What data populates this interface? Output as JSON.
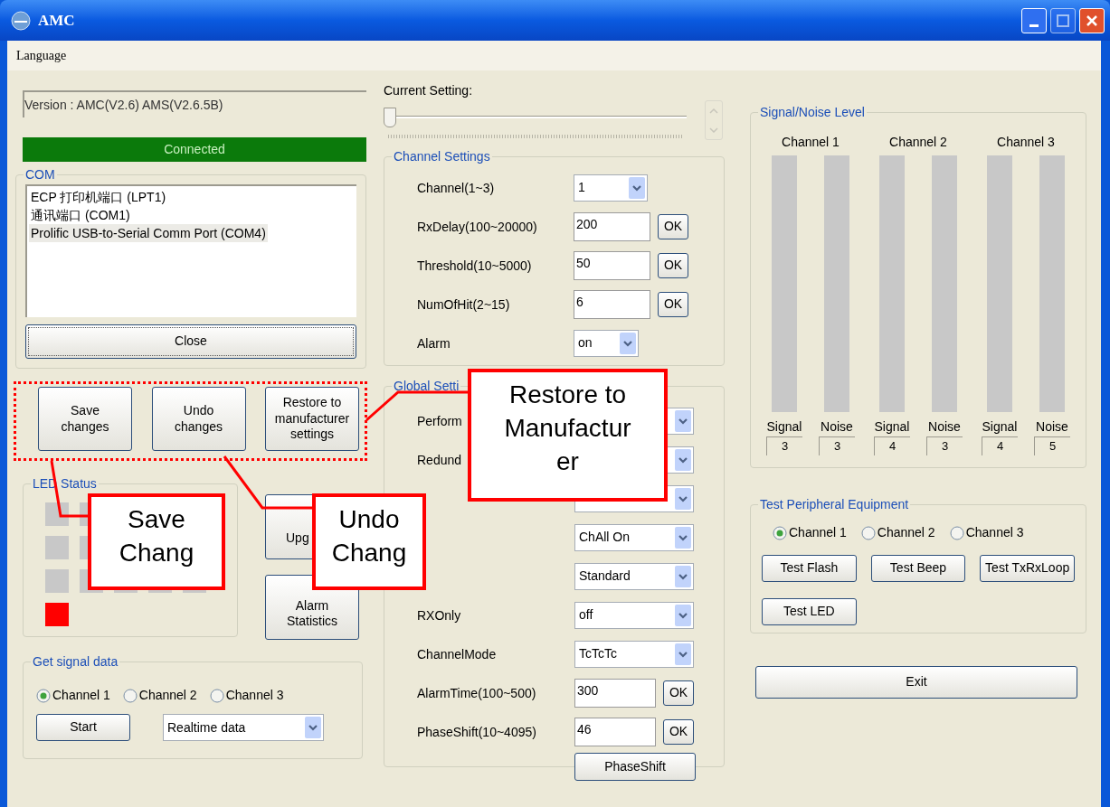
{
  "window": {
    "title": "AMC"
  },
  "menu": [
    "Language"
  ],
  "version": {
    "value": "Version :  AMC(V2.6)  AMS(V2.6.5B)"
  },
  "connection": {
    "status": "Connected",
    "connected": true
  },
  "com": {
    "legend": "COM",
    "ports": [
      {
        "label": "ECP 打印机端口 (LPT1)",
        "selected": false
      },
      {
        "label": "通讯端口 (COM1)",
        "selected": false
      },
      {
        "label": "Prolific USB-to-Serial Comm Port (COM4)",
        "selected": true
      }
    ],
    "close_button": "Close"
  },
  "actions": [
    "Save changes",
    "Undo changes",
    "Restore to manufacturer settings"
  ],
  "led_status": {
    "legend": "LED Status",
    "rows": [
      [
        {
          "color": "#c8c8c8"
        },
        {
          "color": "#c8c8c8"
        }
      ],
      [
        {
          "color": "#c8c8c8"
        },
        {
          "color": "#c8c8c8"
        }
      ],
      [
        {
          "color": "#c8c8c8"
        },
        {
          "color": "#c8c8c8"
        },
        {
          "color": "#c8c8c8"
        },
        {
          "color": "#c8c8c8"
        },
        {
          "color": "#c8c8c8"
        }
      ],
      [
        {
          "color": "#ff0000"
        }
      ]
    ]
  },
  "side_buttons": [
    "Upg",
    "Alarm Statistics"
  ],
  "signal_data": {
    "legend": "Get signal data",
    "channels": [
      {
        "label": "Channel 1",
        "selected": true
      },
      {
        "label": "Channel 2",
        "selected": false
      },
      {
        "label": "Channel 3",
        "selected": false
      }
    ],
    "start_button": "Start",
    "mode": "Realtime data"
  },
  "current_setting": {
    "label": "Current Setting:",
    "level": 0
  },
  "channel_settings": {
    "legend": "Channel Settings",
    "rows": [
      {
        "kind": "select",
        "label": "Channel(1~3)",
        "value": "1"
      },
      {
        "kind": "input",
        "label": "RxDelay(100~20000)",
        "value": "200",
        "button": "OK"
      },
      {
        "kind": "input",
        "label": "Threshold(10~5000)",
        "value": "50",
        "button": "OK"
      },
      {
        "kind": "input",
        "label": "NumOfHit(2~15)",
        "value": "6",
        "button": "OK"
      },
      {
        "kind": "select",
        "label": "Alarm",
        "value": "on"
      }
    ]
  },
  "global_settings": {
    "legend": "Global Setti",
    "rows": [
      {
        "kind": "select",
        "label": "Perform"
      },
      {
        "kind": "select",
        "label": "Redund"
      },
      {
        "kind": "select"
      },
      {
        "kind": "select",
        "value": "ChAll On"
      },
      {
        "kind": "select",
        "value": "Standard"
      },
      {
        "kind": "select",
        "label": "RXOnly",
        "value": "off"
      },
      {
        "kind": "select",
        "label": "ChannelMode",
        "value": "TcTcTc"
      },
      {
        "kind": "input",
        "label": "AlarmTime(100~500)",
        "value": "300",
        "button": "OK"
      },
      {
        "kind": "input",
        "label": "PhaseShift(10~4095)",
        "value": "46",
        "button": "OK"
      }
    ],
    "phase_button": "PhaseShift"
  },
  "signal_noise": {
    "legend": "Signal/Noise Level",
    "channels": [
      {
        "name": "Channel 1",
        "meters": [
          {
            "label": "Signal",
            "value": "3"
          },
          {
            "label": "Noise",
            "value": "3"
          }
        ]
      },
      {
        "name": "Channel 2",
        "meters": [
          {
            "label": "Signal",
            "value": "4"
          },
          {
            "label": "Noise",
            "value": "3"
          }
        ]
      },
      {
        "name": "Channel 3",
        "meters": [
          {
            "label": "Signal",
            "value": "4"
          },
          {
            "label": "Noise",
            "value": "5"
          }
        ]
      }
    ]
  },
  "test_peripheral": {
    "legend": "Test Peripheral Equipment",
    "channels": [
      {
        "label": "Channel 1",
        "selected": true
      },
      {
        "label": "Channel 2",
        "selected": false
      },
      {
        "label": "Channel 3",
        "selected": false
      }
    ],
    "buttons": [
      "Test Flash",
      "Test Beep",
      "Test TxRxLoop",
      "Test LED"
    ]
  },
  "exit_button": "Exit",
  "callouts": [
    {
      "lines": [
        "Restore to",
        "Manufactur",
        "er"
      ]
    },
    {
      "lines": [
        "Save",
        "Chang"
      ]
    },
    {
      "lines": [
        "Undo",
        "Chang"
      ]
    }
  ]
}
